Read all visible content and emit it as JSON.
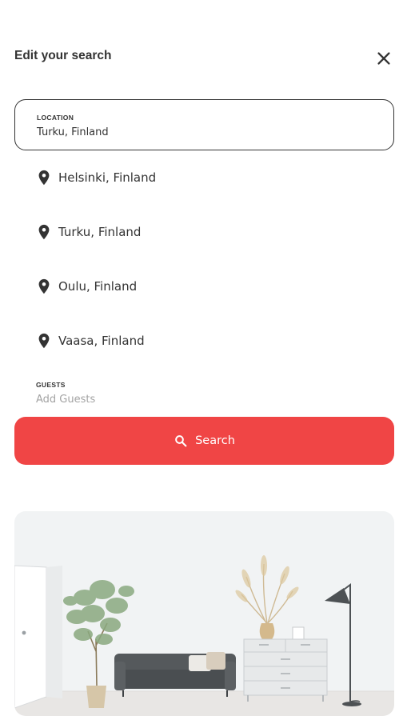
{
  "header": {
    "title": "Edit your search",
    "close_icon": "close-icon"
  },
  "location": {
    "label": "LOCATION",
    "value": "Turku, Finland"
  },
  "suggestions": [
    {
      "label": "Helsinki, Finland",
      "icon": "location-pin-icon"
    },
    {
      "label": "Turku, Finland",
      "icon": "location-pin-icon"
    },
    {
      "label": "Oulu, Finland",
      "icon": "location-pin-icon"
    },
    {
      "label": "Vaasa, Finland",
      "icon": "location-pin-icon"
    }
  ],
  "guests": {
    "label": "GUESTS",
    "placeholder": "Add Guests"
  },
  "search_button": {
    "label": "Search",
    "icon": "search-icon"
  },
  "colors": {
    "accent": "#f04545",
    "text": "#333333",
    "placeholder": "#a3a3a3"
  },
  "hero_image": {
    "icon": "living-room-image"
  }
}
